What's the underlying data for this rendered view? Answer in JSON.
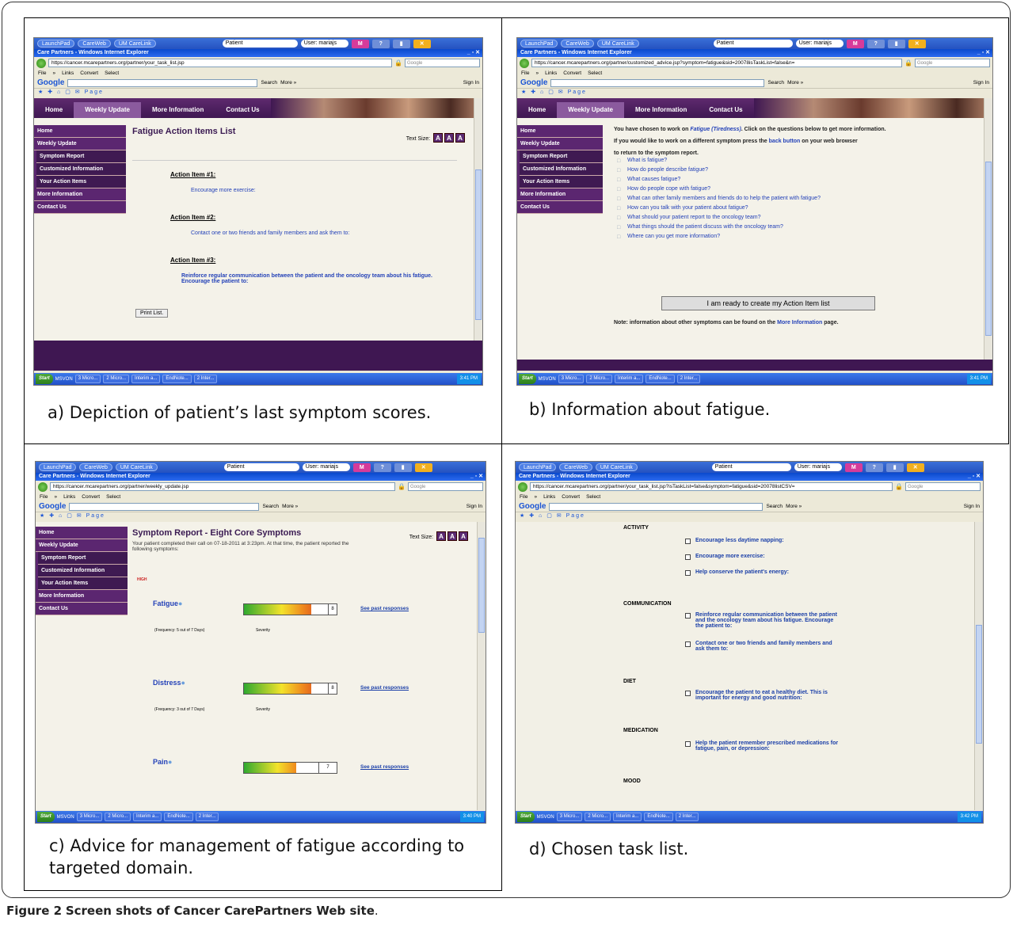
{
  "figure_caption": {
    "label": "Figure 2",
    "text": "Screen shots of Cancer CarePartners Web site"
  },
  "captions": {
    "a": "a) Depiction of patient’s last symptom scores.",
    "b": "b) Information about fatigue.",
    "c": "c) Advice for management of fatigue according to targeted domain.",
    "d": "d) Chosen task list."
  },
  "shared": {
    "launchpad": "LaunchPad",
    "careweb": "CareWeb",
    "umcarelink": "UM CareLink",
    "patient_field": "Patient",
    "user_label": "User: mariajs",
    "ie_title": "Care Partners - Windows Internet Explorer",
    "search_placeholder": "Google",
    "menus": [
      "File",
      "»",
      "Links",
      "Convert",
      "Select"
    ],
    "google_logo": "Google",
    "google_search": "Search",
    "google_more": "More »",
    "sign_in": "Sign In",
    "page_menu": "Page",
    "nav": [
      "Home",
      "Weekly Update",
      "More Information",
      "Contact Us"
    ],
    "sidebar": [
      "Home",
      "Weekly Update",
      "Symptom Report",
      "Customized Information",
      "Your Action Items",
      "More Information",
      "Contact Us"
    ],
    "text_size": "Text Size:",
    "ts_letters": [
      "A",
      "A",
      "A"
    ],
    "taskbar": {
      "start": "Start",
      "msvon": "MSVON",
      "items": [
        "3 Micro...",
        "2 Micro...",
        "Interim a...",
        "EndNote...",
        "2 Inter..."
      ]
    }
  },
  "shot_a": {
    "url": "https://cancer.mcarepartners.org/partner/your_task_list.jsp",
    "title": "Fatigue Action Items List",
    "items": [
      {
        "head": "Action Item #1:",
        "body": "Encourage more exercise:"
      },
      {
        "head": "Action Item #2:",
        "body": "Contact one or two friends and family members and ask them to:"
      },
      {
        "head": "Action Item #3:",
        "body": "Reinforce regular communication between the patient and the oncology team about his fatigue. Encourage the patient to:"
      }
    ],
    "print_button": "Print List.",
    "time": "3:41 PM"
  },
  "shot_b": {
    "url": "https://cancer.mcarepartners.org/partner/customized_advice.jsp?symptom=fatigue&sid=20078isTaskList=false&n=",
    "intro1_pre": "You have chosen to work on",
    "intro1_symptom": "Fatigue (Tiredness)",
    "intro1_post": ". Click on the questions below to get more information.",
    "intro2_pre": "If you would like to work on a different symptom press the",
    "intro2_link": "back button",
    "intro2_post": "on your web browser",
    "intro3": "to return to the symptom report.",
    "questions": [
      "What is fatigue?",
      "How do people describe fatigue?",
      "What causes fatigue?",
      "How do people cope with fatigue?",
      "What can other family members and friends do to help the patient with fatigue?",
      "How can you talk with your patient about fatigue?",
      "What should your patient report to the oncology team?",
      "What things should the patient discuss with the oncology team?",
      "Where can you get more information?"
    ],
    "ready_button": "I am ready to create my Action Item list",
    "note_pre": "Note: information about other symptoms can be found on the",
    "note_link": "More Information",
    "note_post": "page.",
    "time": "3:41 PM"
  },
  "shot_c": {
    "url": "https://cancer.mcarepartners.org/partner/weekly_update.jsp",
    "title": "Symptom Report - Eight Core Symptoms",
    "intro": "Your patient completed their call on 07-18-2011 at 3:23pm. At that time, the patient reported the following symptoms:",
    "level": "HIGH",
    "symptoms": [
      {
        "name": "Fatigue",
        "frequency": "(Frequency: 5 out of 7 Days)",
        "severity_label": "Severity",
        "link": "See past responses",
        "score": "8",
        "fill": 0.8
      },
      {
        "name": "Distress",
        "frequency": "(Frequency: 3 out of 7 Days)",
        "severity_label": "Severity",
        "link": "See past responses",
        "score": "8",
        "fill": 0.8
      },
      {
        "name": "Pain",
        "link": "See past responses",
        "score": "7",
        "fill": 0.7
      }
    ],
    "time": "3:40 PM"
  },
  "shot_d": {
    "url": "https://cancer.mcarepartners.org/partner/your_task_list.jsp?isTaskList=false&symptom=fatigue&sid=20078listCSV=",
    "sections": [
      {
        "head": "ACTIVITY",
        "items": [
          "Encourage less daytime napping:",
          "Encourage more exercise:",
          "Help conserve the patient's energy:"
        ]
      },
      {
        "head": "COMMUNICATION",
        "items": [
          "Reinforce regular communication between the patient and the oncology team about his fatigue. Encourage the patient to:",
          "Contact one or two friends and family members and ask them to:"
        ]
      },
      {
        "head": "DIET",
        "items": [
          "Encourage the patient to eat a healthy diet. This is important for energy and good nutrition:"
        ]
      },
      {
        "head": "MEDICATION",
        "items": [
          "Help the patient remember prescribed medications for fatigue, pain, or depression:"
        ]
      },
      {
        "head": "MOOD",
        "items": []
      }
    ],
    "time": "3:42 PM"
  },
  "colors": {
    "purple": "#5b2670",
    "link": "#2442b8",
    "xp_blue": "#2552c0"
  }
}
